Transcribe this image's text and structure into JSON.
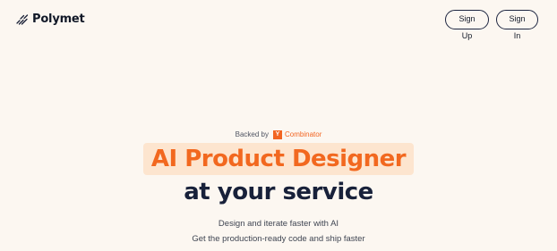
{
  "header": {
    "brand_name": "Polymet",
    "logo_icon": "polymet-logo-icon",
    "signup_label": "Sign Up",
    "signin_label": "Sign In"
  },
  "hero": {
    "backed_by": "Backed by",
    "yc_logo_letter": "Y",
    "yc_name": "Combinator",
    "title_line1": "AI Product Designer",
    "title_line2": "at your service",
    "subtitle_line1": "Design and iterate faster with AI",
    "subtitle_line2": "Get the production-ready code and ship faster"
  },
  "colors": {
    "background": "#fcf7f1",
    "accent": "#f2681f",
    "accent_highlight": "#fde5cf",
    "dark": "#18213a",
    "yc_orange": "#f26522"
  }
}
